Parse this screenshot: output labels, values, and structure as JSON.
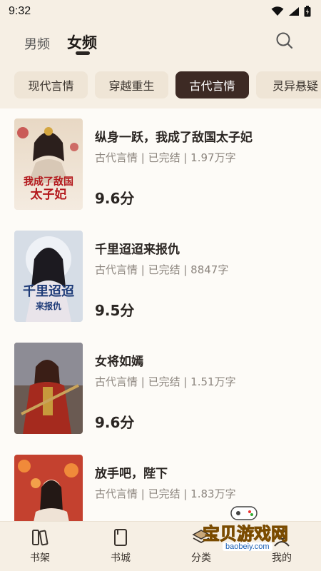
{
  "status_bar": {
    "time": "9:32"
  },
  "header": {
    "tab_male": "男频",
    "tab_female": "女频"
  },
  "categories": [
    {
      "label": "现代言情",
      "active": false
    },
    {
      "label": "穿越重生",
      "active": false
    },
    {
      "label": "古代言情",
      "active": true
    },
    {
      "label": "灵异悬疑",
      "active": false
    }
  ],
  "books": [
    {
      "title": "纵身一跃，我成了敌国太子妃",
      "meta": "古代言情 | 已完结 | 1.97万字",
      "score": "9.6分",
      "cover_text": [
        "我成了敌国",
        "太子妃"
      ]
    },
    {
      "title": "千里迢迢来报仇",
      "meta": "古代言情 | 已完结 | 8847字",
      "score": "9.5分",
      "cover_text": [
        "千里迢迢",
        "来报仇"
      ]
    },
    {
      "title": "女将如嫣",
      "meta": "古代言情 | 已完结 | 1.51万字",
      "score": "9.6分",
      "cover_text": []
    },
    {
      "title": "放手吧，陛下",
      "meta": "古代言情 | 已完结 | 1.83万字",
      "score": "",
      "cover_text": []
    }
  ],
  "bottom_nav": [
    {
      "label": "书架",
      "icon": "bookshelf-icon"
    },
    {
      "label": "书城",
      "icon": "bookstore-icon"
    },
    {
      "label": "分类",
      "icon": "category-icon"
    },
    {
      "label": "我的",
      "icon": "profile-icon"
    }
  ],
  "watermark": {
    "text": "宝贝游戏网",
    "url": "baobeiy.com"
  }
}
